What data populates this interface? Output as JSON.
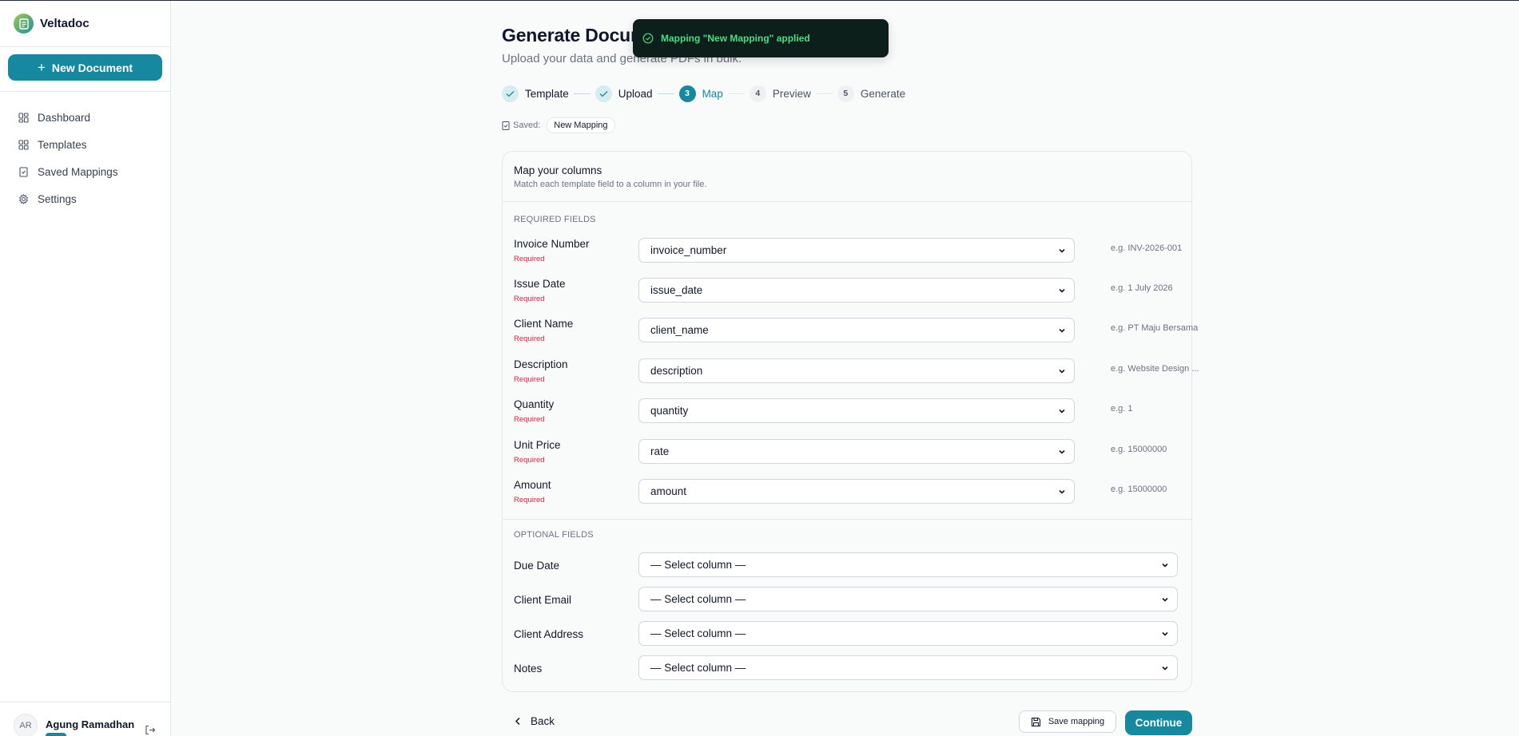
{
  "app": {
    "name": "Veltadoc"
  },
  "sidebar": {
    "new_document_label": "New Document",
    "items": [
      {
        "label": "Dashboard",
        "icon": "dashboard-icon"
      },
      {
        "label": "Templates",
        "icon": "templates-icon"
      },
      {
        "label": "Saved Mappings",
        "icon": "bookmark-icon"
      },
      {
        "label": "Settings",
        "icon": "gear-icon"
      }
    ],
    "user": {
      "initials": "AR",
      "name": "Agung Ramadhan"
    }
  },
  "page": {
    "title": "Generate Documents",
    "subtitle": "Upload your data and generate PDFs in bulk."
  },
  "toast": {
    "message": "Mapping \"New Mapping\" applied",
    "color": "#4ade80"
  },
  "stepper": [
    {
      "number": "1",
      "label": "Template",
      "state": "done"
    },
    {
      "number": "2",
      "label": "Upload",
      "state": "done"
    },
    {
      "number": "3",
      "label": "Map",
      "state": "active"
    },
    {
      "number": "4",
      "label": "Preview",
      "state": "todo"
    },
    {
      "number": "5",
      "label": "Generate",
      "state": "todo"
    }
  ],
  "saved": {
    "label": "Saved:",
    "mapping_name": "New Mapping"
  },
  "card": {
    "title": "Map your columns",
    "description": "Match each template field to a column in your file.",
    "required_section_label": "REQUIRED FIELDS",
    "optional_section_label": "OPTIONAL FIELDS",
    "required_tag": "Required",
    "required_fields": [
      {
        "label": "Invoice Number",
        "value": "invoice_number",
        "hint": "e.g. INV-2026-001"
      },
      {
        "label": "Issue Date",
        "value": "issue_date",
        "hint": "e.g. 1 July 2026"
      },
      {
        "label": "Client Name",
        "value": "client_name",
        "hint": "e.g. PT Maju Bersama"
      },
      {
        "label": "Description",
        "value": "description",
        "hint": "e.g. Website Design ..."
      },
      {
        "label": "Quantity",
        "value": "quantity",
        "hint": "e.g. 1"
      },
      {
        "label": "Unit Price",
        "value": "rate",
        "hint": "e.g. 15000000"
      },
      {
        "label": "Amount",
        "value": "amount",
        "hint": "e.g. 15000000"
      }
    ],
    "optional_fields": [
      {
        "label": "Due Date",
        "value": "— Select column —"
      },
      {
        "label": "Client Email",
        "value": "— Select column —"
      },
      {
        "label": "Client Address",
        "value": "— Select column —"
      },
      {
        "label": "Notes",
        "value": "— Select column —"
      }
    ]
  },
  "footer": {
    "back_label": "Back",
    "save_mapping_label": "Save mapping",
    "continue_label": "Continue"
  },
  "colors": {
    "accent": "#16889f",
    "required": "#e11d48"
  }
}
